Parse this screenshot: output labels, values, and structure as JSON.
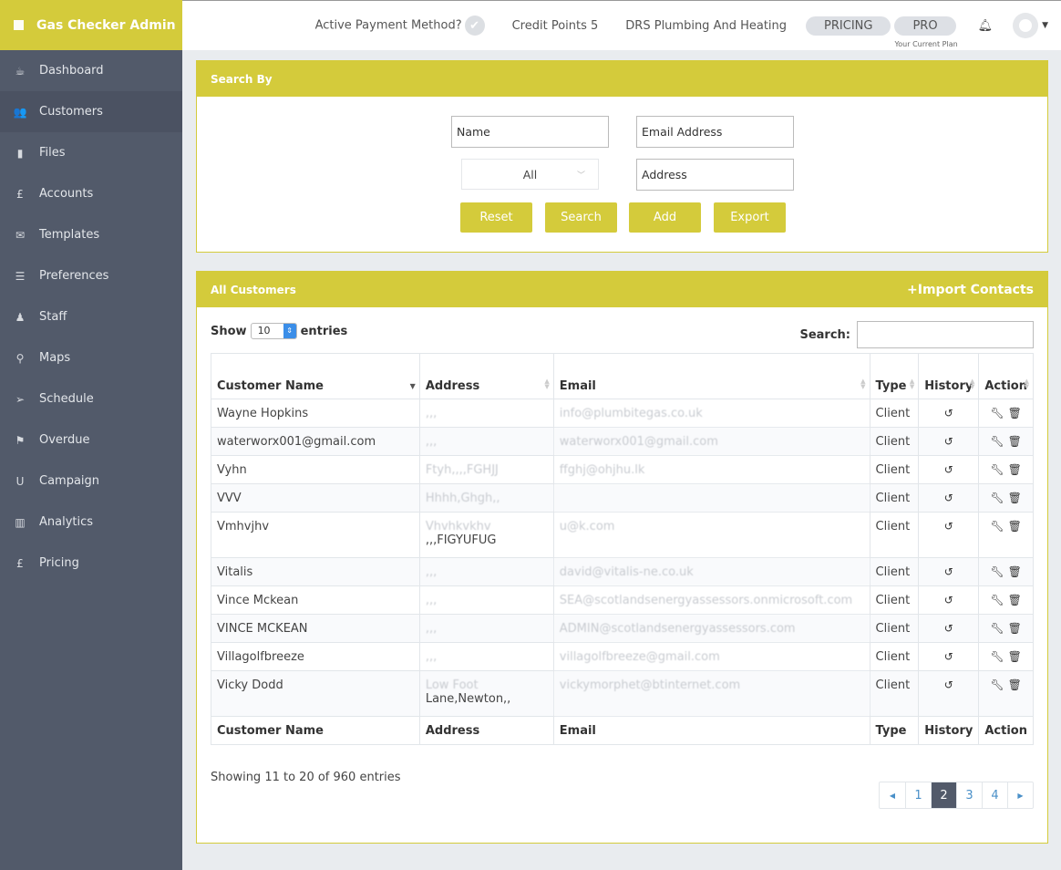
{
  "brand": {
    "title": "Gas Checker Admin"
  },
  "sidebar": {
    "items": [
      {
        "label": "Dashboard",
        "icon": "coffee-icon",
        "glyph": "☕"
      },
      {
        "label": "Customers",
        "icon": "users-icon",
        "glyph": "👥",
        "active": true
      },
      {
        "label": "Files",
        "icon": "file-icon",
        "glyph": "▮"
      },
      {
        "label": "Accounts",
        "icon": "pound-icon",
        "glyph": "£"
      },
      {
        "label": "Templates",
        "icon": "envelope-icon",
        "glyph": "✉"
      },
      {
        "label": "Preferences",
        "icon": "sliders-icon",
        "glyph": "☰"
      },
      {
        "label": "Staff",
        "icon": "male-icon",
        "glyph": "♟"
      },
      {
        "label": "Maps",
        "icon": "map-marker-icon",
        "glyph": "⚲"
      },
      {
        "label": "Schedule",
        "icon": "paper-plane-icon",
        "glyph": "➢"
      },
      {
        "label": "Overdue",
        "icon": "flag-icon",
        "glyph": "⚑"
      },
      {
        "label": "Campaign",
        "icon": "magnet-icon",
        "glyph": "U"
      },
      {
        "label": "Analytics",
        "icon": "bar-chart-icon",
        "glyph": "▥"
      },
      {
        "label": "Pricing",
        "icon": "pound-icon",
        "glyph": "£"
      }
    ]
  },
  "topbar": {
    "payment_label": "Active Payment Method?",
    "credit_label": "Credit Points 5",
    "company": "DRS Plumbing And Heating",
    "pricing_button": "PRICING",
    "plan_button": "PRO",
    "plan_caption": "Your Current Plan"
  },
  "search_panel": {
    "title": "Search By",
    "name_value": "Name",
    "email_value": "Email Address",
    "type_selected": "All",
    "address_value": "Address",
    "buttons": {
      "reset": "Reset",
      "search": "Search",
      "add": "Add",
      "export": "Export"
    }
  },
  "customers_panel": {
    "title": "All Customers",
    "import_link": "+Import Contacts",
    "show_label": "Show",
    "entries_label": "entries",
    "page_length": "10",
    "search_label": "Search:",
    "columns": [
      "Customer Name",
      "Address",
      "Email",
      "Type",
      "History",
      "Action"
    ],
    "rows": [
      {
        "name": "Wayne Hopkins",
        "address": ",,,",
        "address2": "",
        "email": "info@plumbitegas.co.uk",
        "type": "Client"
      },
      {
        "name": "waterworx001@gmail.com",
        "address": ",,,",
        "address2": "",
        "email": "waterworx001@gmail.com",
        "type": "Client"
      },
      {
        "name": "Vyhn",
        "address": "Ftyh,,,,FGHJJ",
        "address2": "",
        "email": "ffghj@ohjhu.lk",
        "type": "Client"
      },
      {
        "name": "VVV",
        "address": "Hhhh,Ghgh,,",
        "address2": "",
        "email": "",
        "type": "Client"
      },
      {
        "name": "Vmhvjhv",
        "address": "Vhvhkvkhv",
        "address2": ",,,FIGYUFUG",
        "email": "u@k.com",
        "type": "Client"
      },
      {
        "name": "Vitalis",
        "address": ",,,",
        "address2": "",
        "email": "david@vitalis-ne.co.uk",
        "type": "Client"
      },
      {
        "name": "Vince Mckean",
        "address": ",,,",
        "address2": "",
        "email": "SEA@scotlandsenergyassessors.onmicrosoft.com",
        "type": "Client"
      },
      {
        "name": "VINCE MCKEAN",
        "address": ",,,",
        "address2": "",
        "email": "ADMIN@scotlandsenergyassessors.com",
        "type": "Client"
      },
      {
        "name": "Villagolfbreeze",
        "address": ",,,",
        "address2": "",
        "email": "villagolfbreeze@gmail.com",
        "type": "Client"
      },
      {
        "name": "Vicky Dodd",
        "address": "Low Foot",
        "address2": "Lane,Newton,,",
        "email": "vickymorphet@btinternet.com",
        "type": "Client"
      }
    ],
    "info": "Showing 11 to 20 of 960 entries",
    "pagination": {
      "pages": [
        "1",
        "2",
        "3",
        "4"
      ],
      "current": "2"
    }
  },
  "colors": {
    "accent": "#d4cb3b",
    "sidebar": "#525a6a",
    "page_bg": "#e9ecef",
    "link": "#4a90c8"
  }
}
